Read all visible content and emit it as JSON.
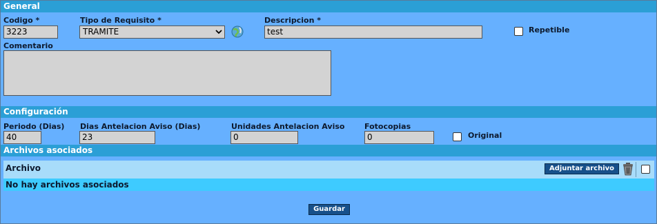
{
  "general": {
    "header": "General",
    "codigo_label": "Codigo *",
    "codigo_value": "3223",
    "tipo_label": "Tipo de Requisito *",
    "tipo_value": "TRAMITE",
    "descripcion_label": "Descripcion *",
    "descripcion_value": "test",
    "repetible_label": "Repetible",
    "comentario_label": "Comentario",
    "comentario_value": ""
  },
  "configuracion": {
    "header": "Configuración",
    "periodo_label": "Periodo (Dias)",
    "periodo_value": "40",
    "dias_aviso_label": "Dias Antelacion Aviso (Dias)",
    "dias_aviso_value": "23",
    "unidades_label": "Unidades Antelacion Aviso",
    "unidades_value": "0",
    "fotocopias_label": "Fotocopias",
    "fotocopias_value": "0",
    "original_label": "Original"
  },
  "archivos": {
    "header": "Archivos asociados",
    "column_label": "Archivo",
    "adjuntar_label": "Adjuntar archivo",
    "empty_text": "No hay archivos asociados"
  },
  "footer": {
    "guardar_label": "Guardar"
  },
  "colors": {
    "background": "#66b0ff",
    "section_header": "#2b9fd6",
    "field": "#d3d3d3",
    "button": "#17508a"
  },
  "icons": {
    "tipo_requisito_action": "globe-link-icon",
    "delete": "trash-can-icon"
  }
}
